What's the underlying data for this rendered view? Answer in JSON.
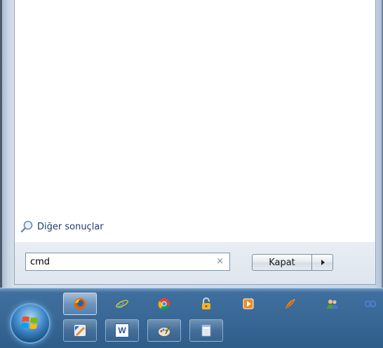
{
  "start_menu": {
    "see_more_results": "Diğer sonuçlar",
    "search": {
      "value": "cmd",
      "clear_glyph": "×"
    },
    "shutdown": {
      "label": "Kapat",
      "arrow_glyph": "▸"
    }
  },
  "taskbar": {
    "start_button": "windows-start-orb",
    "top_row": [
      {
        "name": "firefox-icon",
        "active": true
      },
      {
        "name": "internet-explorer-icon",
        "active": false
      },
      {
        "name": "chrome-icon",
        "active": false
      },
      {
        "name": "lock-icon",
        "active": false
      },
      {
        "name": "media-player-icon",
        "active": false
      },
      {
        "name": "feather-app-icon",
        "active": false
      },
      {
        "name": "users-icon",
        "active": false
      },
      {
        "name": "infinity-icon",
        "active": false
      }
    ],
    "bottom_row": [
      {
        "name": "pencil-app-icon",
        "active": false
      },
      {
        "name": "word-icon",
        "label": "W",
        "active": false
      },
      {
        "name": "paint-icon",
        "active": false
      },
      {
        "name": "notepad-icon",
        "active": false
      }
    ]
  },
  "colors": {
    "taskbar": "#3a6896",
    "link_text": "#1f3a6e",
    "menu_frame": "#c9d6e4"
  }
}
